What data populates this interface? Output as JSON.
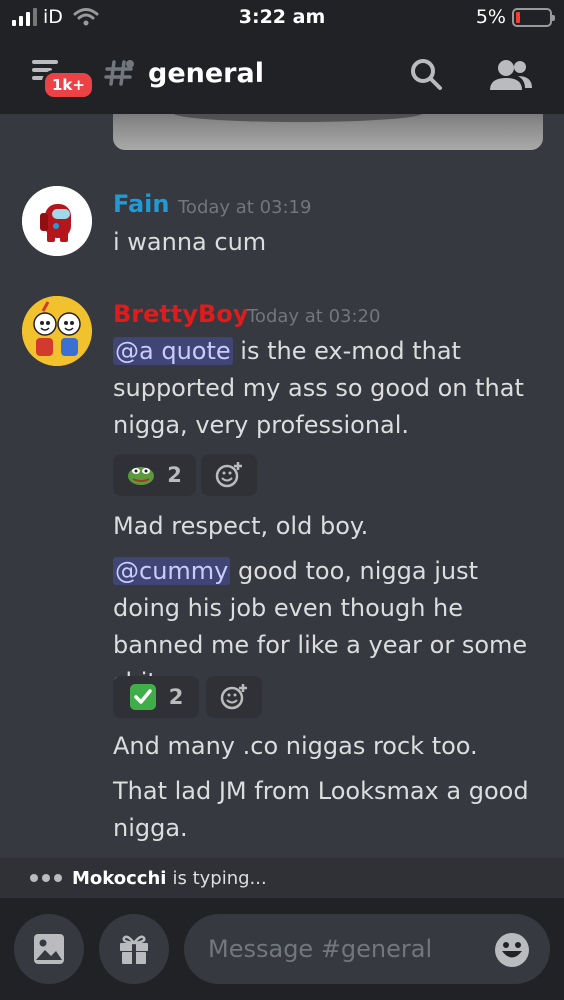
{
  "status_bar": {
    "carrier": "iD",
    "time": "3:22 am",
    "battery": "5%"
  },
  "header": {
    "badge": "1k+",
    "channel": "general"
  },
  "messages": [
    {
      "author": "Fain",
      "author_color": "#1e9bd7",
      "timestamp": "Today at 03:19",
      "lines": [
        "i wanna cum"
      ]
    },
    {
      "author": "BrettyBoy",
      "author_color": "#e01b1b",
      "timestamp": "Today at 03:20",
      "m1": {
        "mention": "@a quote",
        "text": " is the ex-mod that supported my ass so good on that nigga, very professional."
      },
      "reaction1": {
        "emoji": "pepe-frog-icon",
        "count": "2"
      },
      "m2": "Mad respect, old boy.",
      "m3": {
        "mention": "@cummy",
        "text": " good too, nigga just doing his job even though he banned me for like a year or some shit."
      },
      "reaction2": {
        "emoji": "check-mark-icon",
        "count": "2"
      },
      "m4": "And many .co niggas rock too.",
      "m5": "That lad JM from Looksmax a good nigga."
    }
  ],
  "typing": {
    "user": "Mokocchi",
    "text": "is typing..."
  },
  "composer": {
    "placeholder": "Message #general"
  }
}
